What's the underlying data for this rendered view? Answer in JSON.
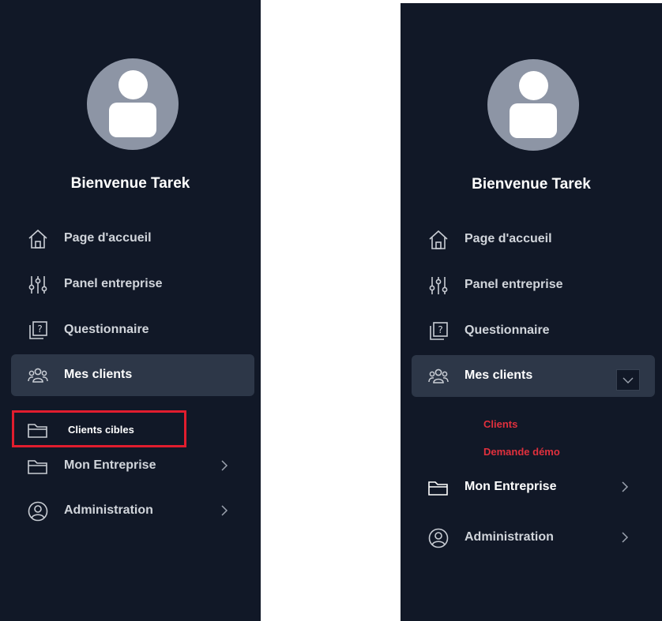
{
  "left_panel": {
    "welcome": "Bienvenue Tarek",
    "nav": [
      {
        "label": "Page d'accueil",
        "icon": "home-icon"
      },
      {
        "label": "Panel entreprise",
        "icon": "sliders-icon"
      },
      {
        "label": "Questionnaire",
        "icon": "question-book-icon"
      },
      {
        "label": "Mes clients",
        "icon": "users-icon",
        "active": true
      },
      {
        "label": "Clients cibles",
        "icon": "folder-icon",
        "highlighted": true
      },
      {
        "label": "Mon Entreprise",
        "icon": "folder-icon",
        "chevron": "chevron-right-icon"
      },
      {
        "label": "Administration",
        "icon": "user-circle-icon",
        "chevron": "chevron-right-icon"
      }
    ]
  },
  "right_panel": {
    "welcome": "Bienvenue Tarek",
    "nav": [
      {
        "label": "Page d'accueil",
        "icon": "home-icon"
      },
      {
        "label": "Panel entreprise",
        "icon": "sliders-icon"
      },
      {
        "label": "Questionnaire",
        "icon": "question-book-icon"
      },
      {
        "label": "Mes clients",
        "icon": "users-icon",
        "active": true,
        "toggle": "chevron-down-icon"
      },
      {
        "label": "Mon Entreprise",
        "icon": "folder-icon",
        "chevron": "chevron-right-icon"
      },
      {
        "label": "Administration",
        "icon": "user-circle-icon",
        "chevron": "chevron-right-icon"
      }
    ],
    "submenu": [
      {
        "label": "Clients"
      },
      {
        "label": "Demande démo"
      }
    ]
  },
  "colors": {
    "sidebar_bg": "#111827",
    "active_bg": "#2d3748",
    "nav_text": "#d1d5db",
    "highlight_red": "#e11d2e",
    "submenu_red": "#e0303d",
    "avatar_bg": "#8d95a5"
  }
}
